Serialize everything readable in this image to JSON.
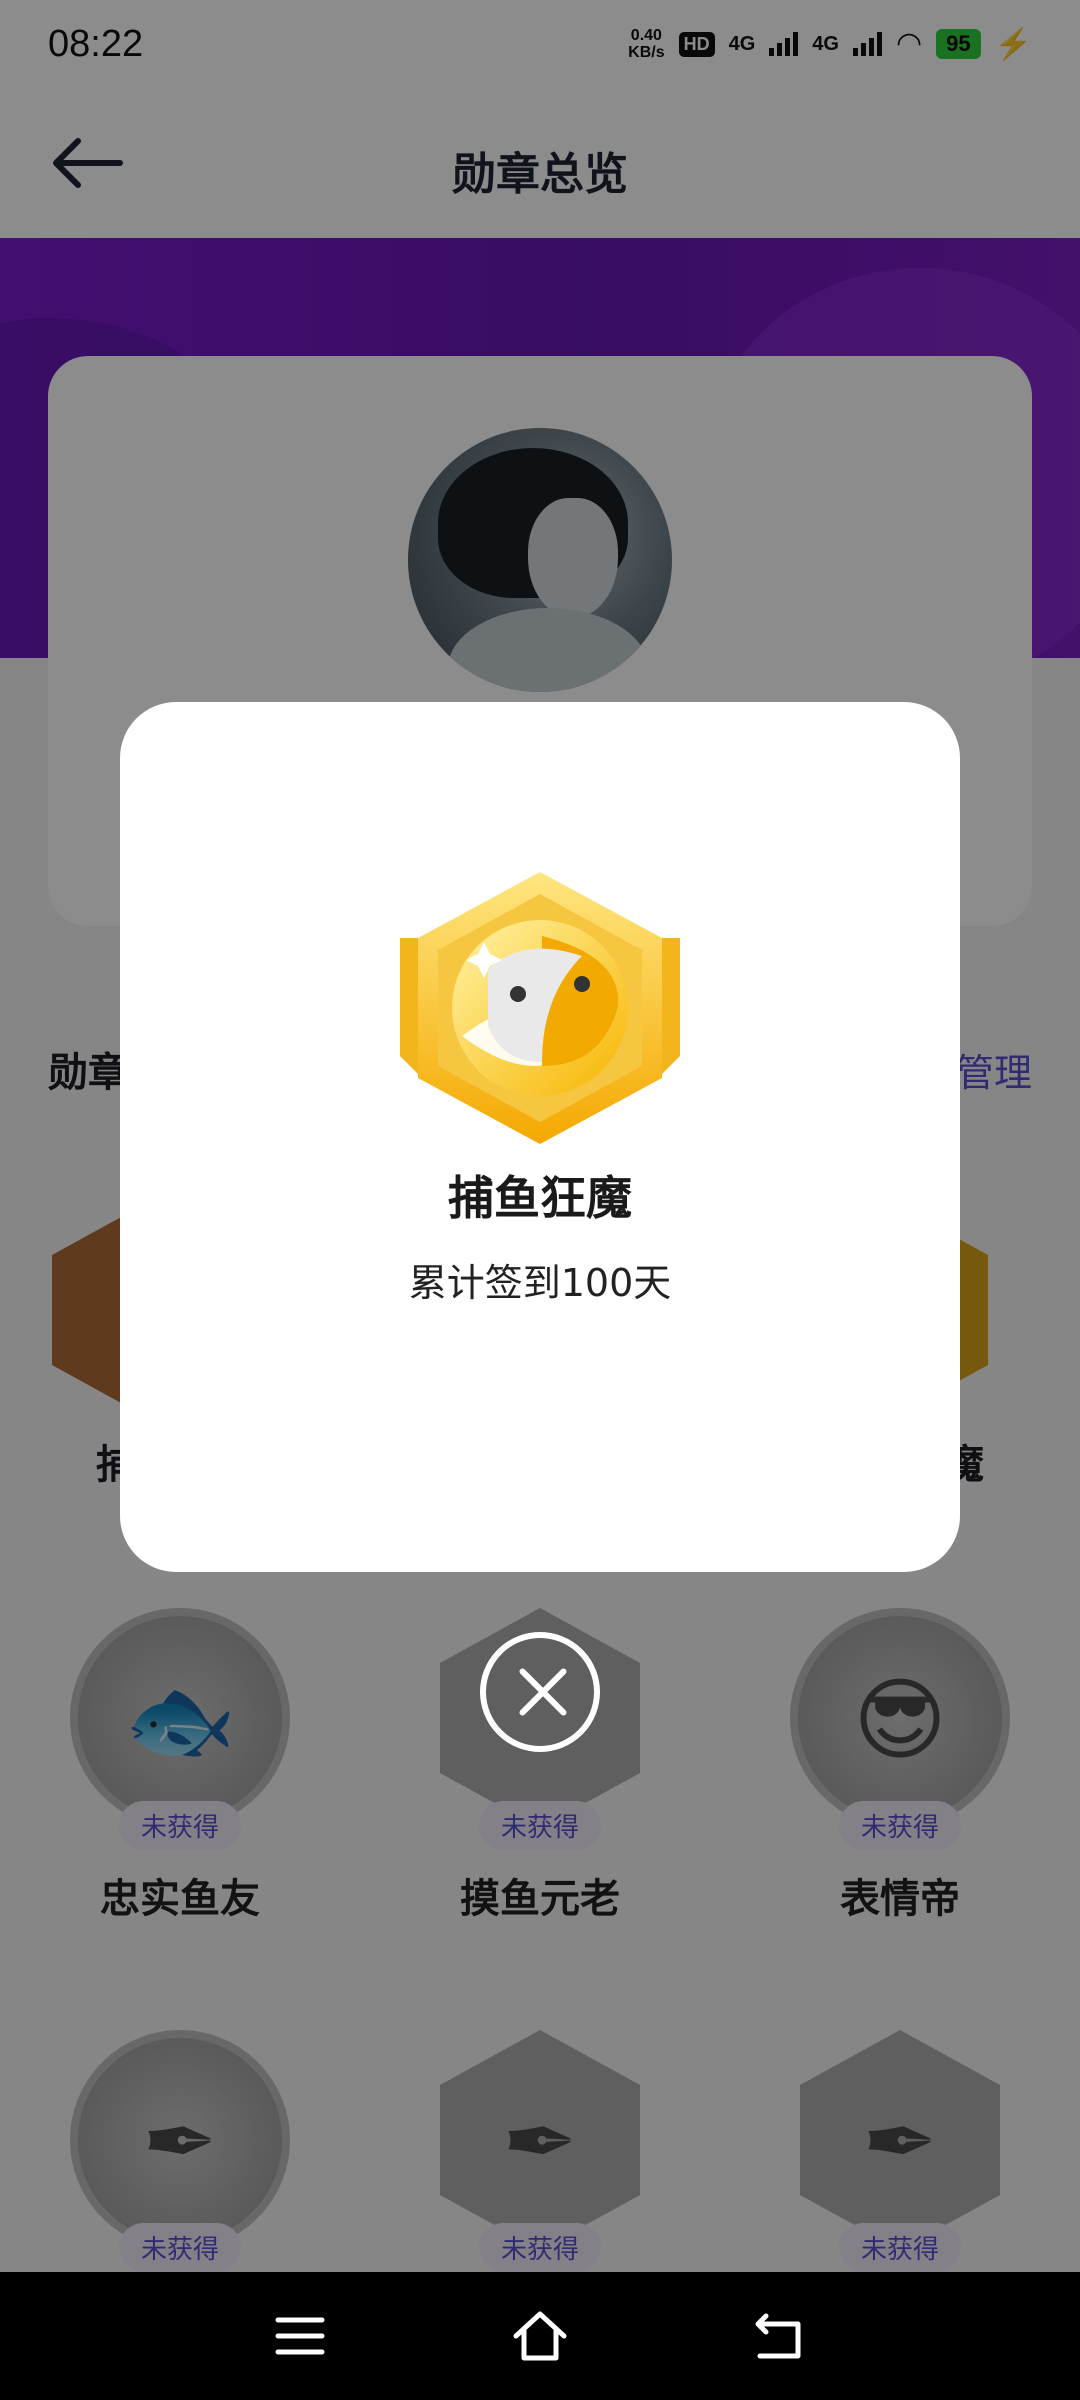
{
  "status_bar": {
    "time": "08:22",
    "net_speed_value": "0.40",
    "net_speed_unit": "KB/s",
    "hd_label": "HD",
    "signal1_label": "4G",
    "signal2_label": "4G",
    "battery": "95"
  },
  "header": {
    "title": "勋章总览"
  },
  "section": {
    "title": "勋章",
    "link": "管理"
  },
  "badges_top_row": [
    {
      "name": "捕"
    },
    {
      "name": "魔"
    }
  ],
  "badges": [
    {
      "name": "忠实鱼友",
      "status": "未获得"
    },
    {
      "name": "摸鱼元老",
      "status": "未获得"
    },
    {
      "name": "表情帝",
      "status": "未获得"
    },
    {
      "name": "",
      "status": "未获得"
    },
    {
      "name": "",
      "status": "未获得"
    },
    {
      "name": "",
      "status": "未获得"
    }
  ],
  "modal": {
    "badge_name": "捕鱼狂魔",
    "description": "累计签到100天"
  }
}
